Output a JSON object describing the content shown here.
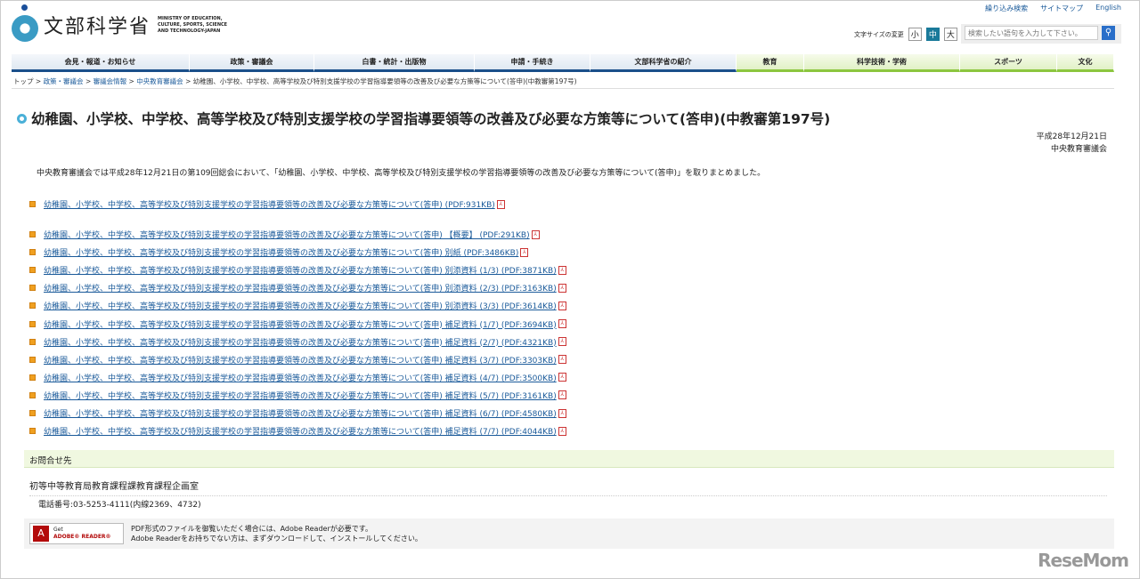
{
  "header": {
    "logo_jp": "文部科学省",
    "logo_en": "MINISTRY OF EDUCATION, CULTURE, SPORTS, SCIENCE AND TECHNOLOGY-JAPAN",
    "util": [
      "繰り込み検索",
      "サイトマップ",
      "English"
    ],
    "fontsize_label": "文字サイズの変更",
    "fontsizes": [
      "小",
      "中",
      "大"
    ],
    "search_placeholder": "検索したい語句を入力して下さい。"
  },
  "nav": [
    "会見・報道・お知らせ",
    "政策・審議会",
    "白書・統計・出版物",
    "申請・手続き",
    "文部科学省の紹介",
    "教育",
    "科学技術・学術",
    "スポーツ",
    "文化"
  ],
  "breadcrumb": [
    "トップ",
    "政策・審議会",
    "審議会情報",
    "中央教育審議会"
  ],
  "breadcrumb_current": "幼稚園、小学校、中学校、高等学校及び特別支援学校の学習指導要領等の改善及び必要な方策等について(答申)(中教審第197号)",
  "title": "幼稚園、小学校、中学校、高等学校及び特別支援学校の学習指導要領等の改善及び必要な方策等について(答申)(中教審第197号)",
  "date": "平成28年12月21日",
  "org": "中央教育審議会",
  "description": "中央教育審議会では平成28年12月21日の第109回総会において、「幼稚園、小学校、中学校、高等学校及び特別支援学校の学習指導要領等の改善及び必要な方策等について(答申)」を取りまとめました。",
  "links": [
    "幼稚園、小学校、中学校、高等学校及び特別支援学校の学習指導要領等の改善及び必要な方策等について(答申) (PDF:931KB)",
    "幼稚園、小学校、中学校、高等学校及び特別支援学校の学習指導要領等の改善及び必要な方策等について(答申) 【概要】 (PDF:291KB)",
    "幼稚園、小学校、中学校、高等学校及び特別支援学校の学習指導要領等の改善及び必要な方策等について(答申) 別紙 (PDF:3486KB)",
    "幼稚園、小学校、中学校、高等学校及び特別支援学校の学習指導要領等の改善及び必要な方策等について(答申) 別添資料 (1/3) (PDF:3871KB)",
    "幼稚園、小学校、中学校、高等学校及び特別支援学校の学習指導要領等の改善及び必要な方策等について(答申) 別添資料 (2/3) (PDF:3163KB)",
    "幼稚園、小学校、中学校、高等学校及び特別支援学校の学習指導要領等の改善及び必要な方策等について(答申) 別添資料 (3/3) (PDF:3614KB)",
    "幼稚園、小学校、中学校、高等学校及び特別支援学校の学習指導要領等の改善及び必要な方策等について(答申) 補足資料 (1/7) (PDF:3694KB)",
    "幼稚園、小学校、中学校、高等学校及び特別支援学校の学習指導要領等の改善及び必要な方策等について(答申) 補足資料 (2/7) (PDF:4321KB)",
    "幼稚園、小学校、中学校、高等学校及び特別支援学校の学習指導要領等の改善及び必要な方策等について(答申) 補足資料 (3/7) (PDF:3303KB)",
    "幼稚園、小学校、中学校、高等学校及び特別支援学校の学習指導要領等の改善及び必要な方策等について(答申) 補足資料 (4/7) (PDF:3500KB)",
    "幼稚園、小学校、中学校、高等学校及び特別支援学校の学習指導要領等の改善及び必要な方策等について(答申) 補足資料 (5/7) (PDF:3161KB)",
    "幼稚園、小学校、中学校、高等学校及び特別支援学校の学習指導要領等の改善及び必要な方策等について(答申) 補足資料 (6/7) (PDF:4580KB)",
    "幼稚園、小学校、中学校、高等学校及び特別支援学校の学習指導要領等の改善及び必要な方策等について(答申) 補足資料 (7/7) (PDF:4044KB)"
  ],
  "contact": {
    "heading": "お問合せ先",
    "office": "初等中等教育局教育課程課教育課程企画室",
    "tel": "電話番号:03-5253-4111(内線2369、4732)"
  },
  "adobe": {
    "get": "Get",
    "reader": "ADOBE® READER®",
    "line1": "PDF形式のファイルを御覧いただく場合には、Adobe Readerが必要です。",
    "line2": "Adobe Readerをお持ちでない方は、まずダウンロードして、インストールしてください。"
  },
  "watermark": "ReseMom"
}
